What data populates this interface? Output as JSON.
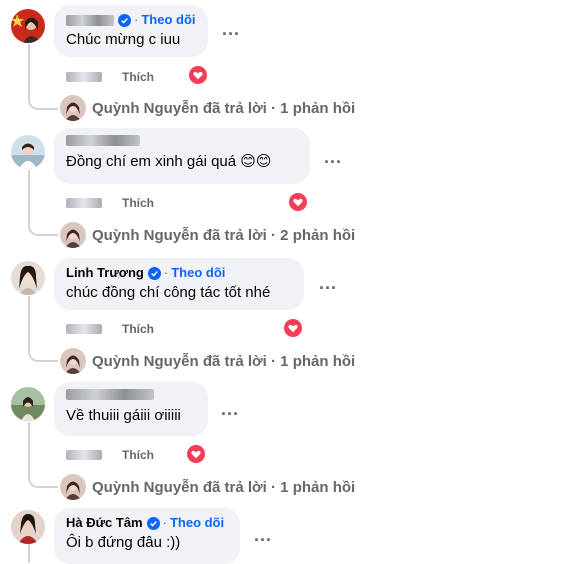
{
  "colors": {
    "link": "#0866ff",
    "heart": "#f33e58",
    "bubble": "#f0f2f5",
    "muted": "#65676b"
  },
  "comments": [
    {
      "name": "",
      "name_blurred": true,
      "verified": true,
      "follow": "Theo dõi",
      "text": "Chúc mừng c iuu",
      "more": "...",
      "like": "Thích",
      "reaction": "heart-icon",
      "reply": "Quỳnh Nguyễn đã trả lời · 1 phản hồi"
    },
    {
      "name": "",
      "name_blurred": true,
      "verified": false,
      "follow": "",
      "text": "Đồng chí em xinh gái quá 😊😊",
      "more": "...",
      "like": "Thích",
      "reaction": "heart-icon",
      "reply": "Quỳnh Nguyễn đã trả lời · 2 phản hồi"
    },
    {
      "name": "Linh Trương",
      "name_blurred": false,
      "verified": true,
      "follow": "Theo dõi",
      "text": "chúc đồng chí công tác tốt nhé",
      "more": "...",
      "like": "Thích",
      "reaction": "heart-icon",
      "reply": "Quỳnh Nguyễn đã trả lời · 1 phản hồi"
    },
    {
      "name": "",
      "name_blurred": true,
      "verified": false,
      "follow": "",
      "text": "Về thuiii gáiii ơiiiii",
      "more": "...",
      "like": "Thích",
      "reaction": "heart-icon",
      "reply": "Quỳnh Nguyễn đã trả lời · 1 phản hồi"
    },
    {
      "name": "Hà Đức Tâm",
      "name_blurred": false,
      "verified": true,
      "follow": "Theo dõi",
      "text": "Ôi b đứng đâu :))",
      "more": "..."
    }
  ]
}
